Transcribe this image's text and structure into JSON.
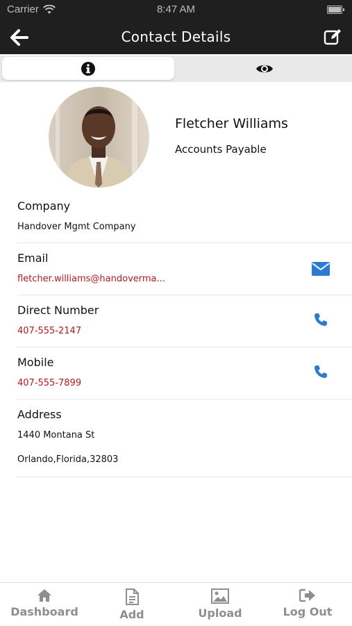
{
  "status_bar": {
    "carrier": "Carrier",
    "time": "8:47 AM"
  },
  "nav": {
    "title": "Contact Details",
    "back_icon": "arrow-left-icon",
    "edit_icon": "edit-icon"
  },
  "tabs": [
    {
      "icon": "info-icon",
      "active": true
    },
    {
      "icon": "eye-icon",
      "active": false
    }
  ],
  "contact": {
    "name": "Fletcher Williams",
    "role": "Accounts Payable",
    "company_label": "Company",
    "company": "Handover Mgmt Company",
    "email_label": "Email",
    "email": "fletcher.williams@handoverma...",
    "direct_label": "Direct Number",
    "direct": "407-555-2147",
    "mobile_label": "Mobile",
    "mobile": "407-555-7899",
    "address_label": "Address",
    "address_line1": "1440 Montana St",
    "address_line2": "Orlando,Florida,32803"
  },
  "tab_bar": [
    {
      "label": "Dashboard",
      "icon": "home-icon"
    },
    {
      "label": "Add",
      "icon": "document-icon"
    },
    {
      "label": "Upload",
      "icon": "image-icon"
    },
    {
      "label": "Log Out",
      "icon": "logout-icon"
    }
  ],
  "colors": {
    "header": "#1f1f1f",
    "link": "#b11b1b",
    "action_blue": "#2a7bd1",
    "tab_gray": "#8e8e8e"
  }
}
